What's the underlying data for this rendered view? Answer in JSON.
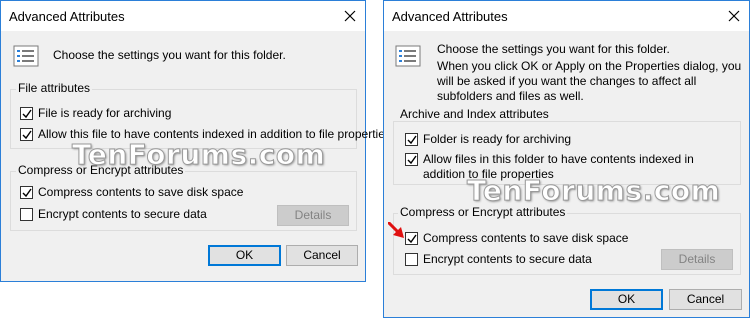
{
  "left_dialog": {
    "title": "Advanced Attributes",
    "close_icon": "close-icon",
    "intro": "Choose the settings you want for this folder.",
    "file_attributes": {
      "label": "File attributes",
      "items": [
        {
          "label": "File is ready for archiving",
          "checked": true
        },
        {
          "label": "Allow this file to have contents indexed in addition to file properties",
          "checked": true
        }
      ]
    },
    "compress_encrypt": {
      "label": "Compress or Encrypt attributes",
      "items": [
        {
          "label": "Compress contents to save disk space",
          "checked": true
        },
        {
          "label": "Encrypt contents to secure data",
          "checked": false
        }
      ],
      "details_label": "Details"
    },
    "ok_label": "OK",
    "cancel_label": "Cancel"
  },
  "right_dialog": {
    "title": "Advanced Attributes",
    "close_icon": "close-icon",
    "intro": "Choose the settings you want for this folder.",
    "sub_intro": "When you click OK or Apply on the Properties dialog, you will be asked if you want the changes to affect all subfolders and files as well.",
    "archive_index": {
      "label": "Archive and Index attributes",
      "items": [
        {
          "label": "Folder is ready for archiving",
          "checked": true
        },
        {
          "label": "Allow files in this folder to have contents indexed in addition to file properties",
          "checked": true
        }
      ]
    },
    "compress_encrypt": {
      "label": "Compress or Encrypt attributes",
      "items": [
        {
          "label": "Compress contents to save disk space",
          "checked": true
        },
        {
          "label": "Encrypt contents to secure data",
          "checked": false
        }
      ],
      "details_label": "Details"
    },
    "ok_label": "OK",
    "cancel_label": "Cancel"
  },
  "watermark": "TenForums.com",
  "colors": {
    "dialog_bg": "#f0f0f0",
    "border_accent": "#2b7fd8",
    "default_button_border": "#0078d7",
    "arrow": "#e01010"
  }
}
